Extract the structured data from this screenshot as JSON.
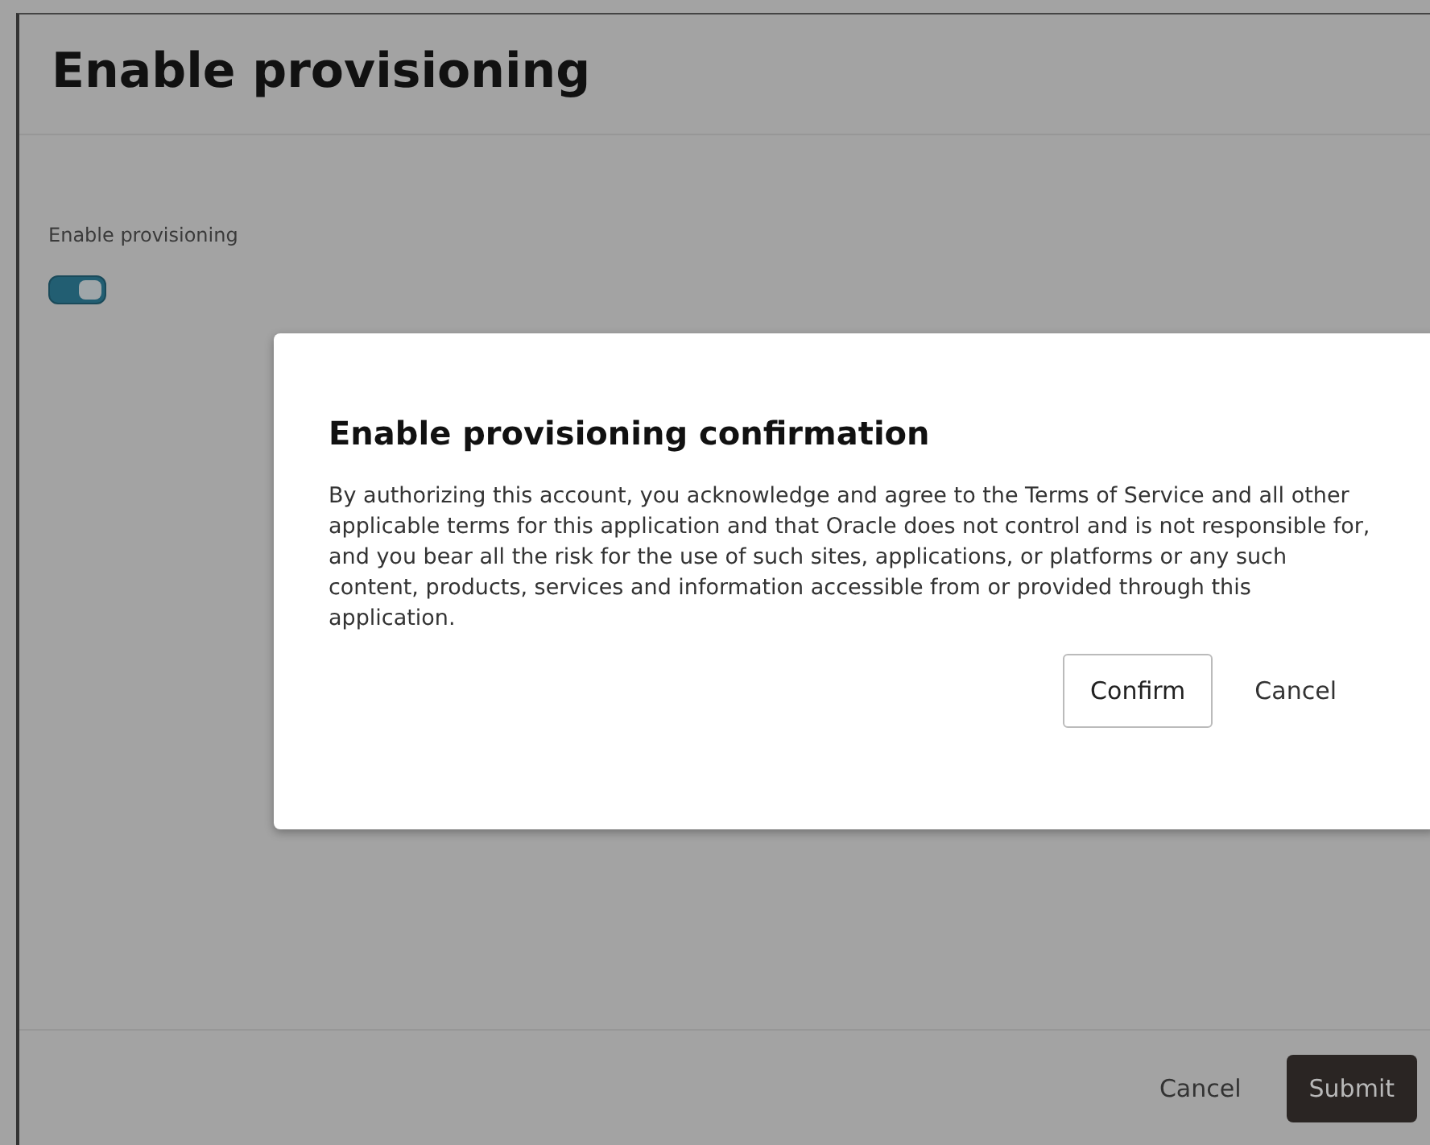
{
  "page": {
    "title": "Enable provisioning"
  },
  "form": {
    "toggle_label": "Enable provisioning",
    "toggle_on": true
  },
  "dialog": {
    "title": "Enable provisioning confirmation",
    "message": "By authorizing this account, you acknowledge and agree to the Terms of Service and all other applicable terms for this application and that Oracle does not control and is not responsible for, and you bear all the risk for the use of such sites, applications, or platforms or any such content, products, services and information accessible from or provided through this application.",
    "buttons": [
      {
        "label": "Confirm",
        "kind": "outlined"
      },
      {
        "label": "Cancel",
        "kind": "text"
      }
    ]
  },
  "footer": {
    "buttons": [
      {
        "label": "Cancel",
        "kind": "text"
      },
      {
        "label": "Submit",
        "kind": "primary"
      }
    ]
  }
}
